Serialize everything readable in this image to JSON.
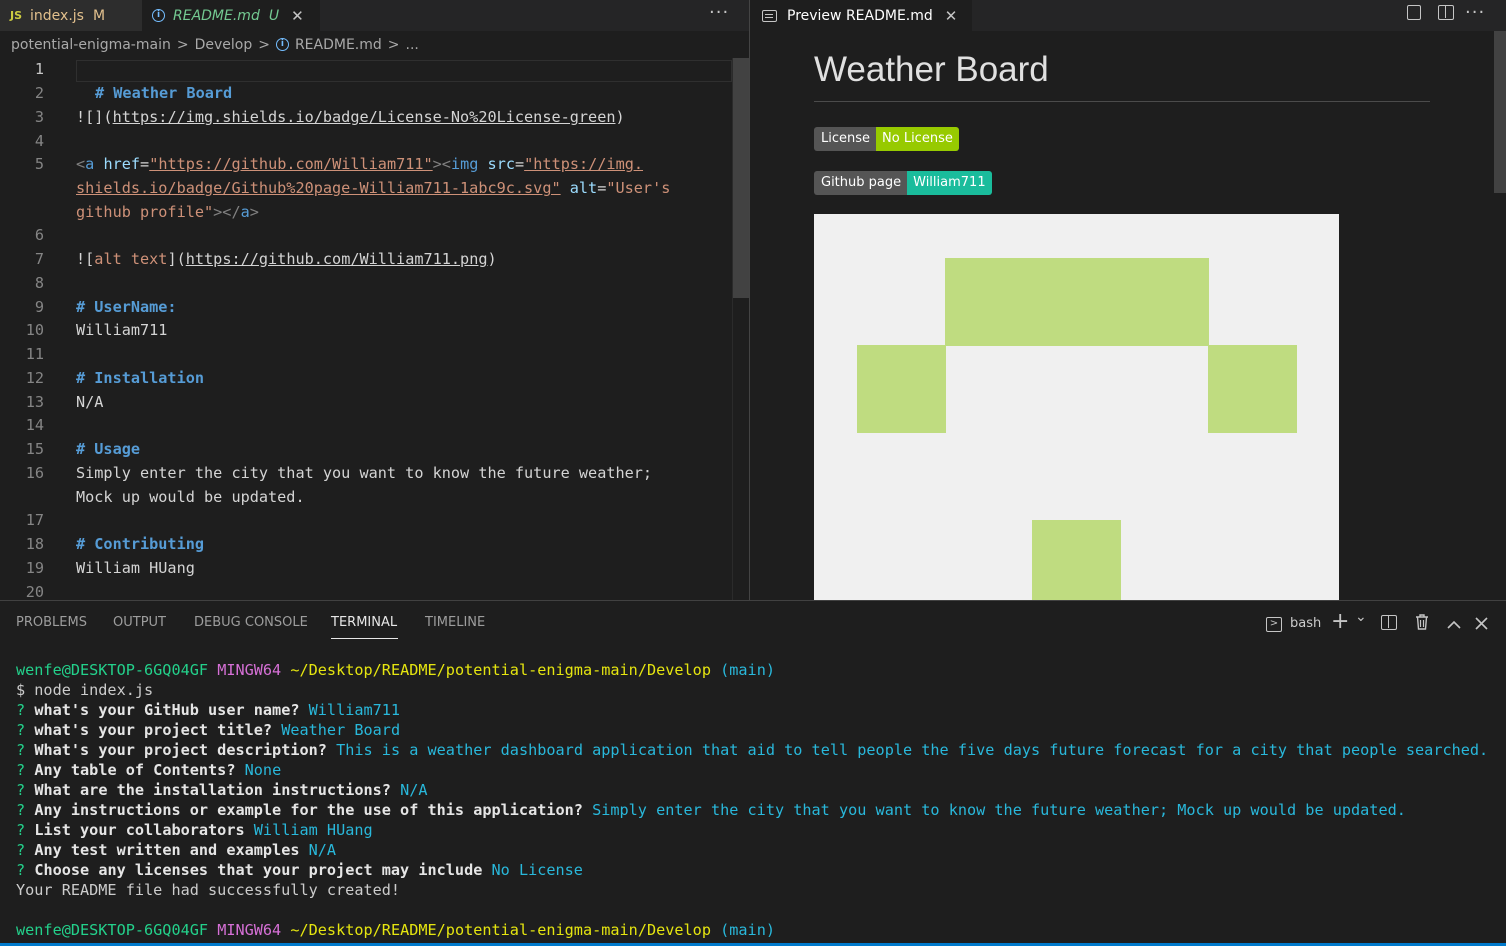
{
  "tabs": {
    "index_js": {
      "badge": "JS",
      "label": "index.js",
      "status": "M"
    },
    "readme_md": {
      "label": "README.md",
      "status": "U",
      "close": "✕"
    },
    "more": "···"
  },
  "breadcrumb": {
    "items": [
      "potential-enigma-main",
      "Develop",
      "README.md",
      "..."
    ],
    "separator": ">"
  },
  "editor": {
    "line_numbers": [
      "1",
      "2",
      "3",
      "4",
      "5",
      "6",
      "7",
      "8",
      "9",
      "10",
      "11",
      "12",
      "13",
      "14",
      "15",
      "16",
      "17",
      "18",
      "19",
      "20"
    ],
    "l2": "# Weather Board",
    "l3_a": "![](",
    "l3_url": "https://img.shields.io/badge/License-No%20License-green",
    "l3_b": ")",
    "l5_open": "<a ",
    "l5_href": "href",
    "l5_eq": "=",
    "l5_href_val": "\"https://github.com/William711\"",
    "l5_img_open": "><img ",
    "l5_src": "src",
    "l5_src_val_1": "\"https://img.",
    "l5_src_val_2": "shields.io/badge/Github%20page-William711-1abc9c.svg\"",
    "l5_alt": " alt",
    "l5_alt_val_1": "\"User's",
    "l5_alt_val_2": "github profile\"",
    "l5_close": "></a>",
    "l7_a": "![",
    "l7_alt": "alt text",
    "l7_b": "](",
    "l7_url": "https://github.com/William711.png",
    "l7_c": ")",
    "l9": "# UserName:",
    "l10": "William711",
    "l12": "# Installation",
    "l13": "N/A",
    "l15": "# Usage",
    "l16_1": "Simply enter the city that you want to know the future weather;",
    "l16_2": "Mock up would be updated.",
    "l18": "# Contributing",
    "l19": "William HUang"
  },
  "preview": {
    "tab_label": "Preview README.md",
    "tab_close": "✕",
    "title": "Weather Board",
    "license_badge": {
      "key": "License",
      "value": "No License",
      "color": "#97ca00"
    },
    "github_badge": {
      "key": "Github page",
      "value": "William711",
      "color": "#1abc9c"
    },
    "identicon_color": "#bfdc80"
  },
  "panel": {
    "tabs": [
      "PROBLEMS",
      "OUTPUT",
      "DEBUG CONSOLE",
      "TERMINAL",
      "TIMELINE"
    ],
    "active_tab": "TERMINAL",
    "shell": "bash",
    "add": "+",
    "chevron": "⌄"
  },
  "terminal": {
    "prompt_user": "wenfe@DESKTOP-6GQ04GF",
    "prompt_env": "MINGW64",
    "prompt_path": "~/Desktop/README/potential-enigma-main/Develop",
    "prompt_branch": "(main)",
    "command": "$ node index.js",
    "qmark": "?",
    "qa": [
      {
        "q": "what's your GitHub user name?",
        "a": "William711"
      },
      {
        "q": "what's your project title?",
        "a": "Weather Board"
      },
      {
        "q": "What's your project description?",
        "a": "This is a weather dashboard application that aid to tell people the five days future forecast for a city that people searched."
      },
      {
        "q": "Any table of Contents?",
        "a": "None"
      },
      {
        "q": "What are the installation instructions?",
        "a": "N/A"
      },
      {
        "q": "Any instructions or example for the use of this application?",
        "a": "Simply enter the city that you want to know the future weather; Mock up would be updated."
      },
      {
        "q": "List your collaborators",
        "a": "William HUang"
      },
      {
        "q": "Any test written and examples",
        "a": "N/A"
      },
      {
        "q": "Choose any licenses that your project may include",
        "a": "No License"
      }
    ],
    "result": "Your README file had successfully created!"
  }
}
